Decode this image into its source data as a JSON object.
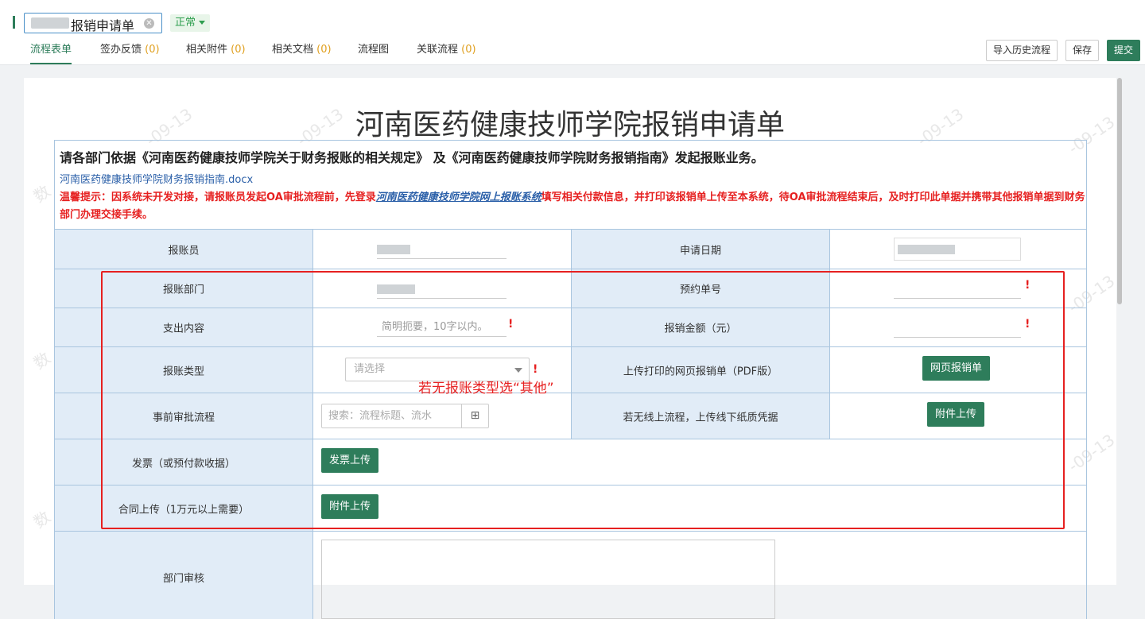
{
  "header": {
    "title": "报销申请单",
    "status": "正常",
    "tabs": [
      {
        "label": "流程表单",
        "count": ""
      },
      {
        "label": "签办反馈",
        "count": "(0)"
      },
      {
        "label": "相关附件",
        "count": "(0)"
      },
      {
        "label": "相关文档",
        "count": "(0)"
      },
      {
        "label": "流程图",
        "count": ""
      },
      {
        "label": "关联流程",
        "count": "(0)"
      }
    ],
    "buttons": {
      "import": "导入历史流程",
      "save": "保存",
      "submit": "提交"
    }
  },
  "watermark": {
    "date": "-09-13",
    "prefix": "数"
  },
  "form": {
    "title": "河南医药健康技师学院报销申请单",
    "notice_line1": "请各部门依据《河南医药健康技师学院关于财务报账的相关规定》 及《河南医药健康技师学院财务报销指南》发起报账业务。",
    "guide_link": "河南医药健康技师学院财务报销指南.docx",
    "tip_prefix": "温馨提示：因系统未开发对接，请报账员发起OA审批流程前，先登录",
    "tip_link": "河南医药健康技师学院网上报账系统",
    "tip_suffix": "填写相关付款信息，并打印该报销单上传至本系统，待OA审批流程结束后，及时打印此单据并携带其他报销单据到财务部门办理交接手续。",
    "labels": {
      "reporter": "报账员",
      "apply_date": "申请日期",
      "department": "报账部门",
      "booking_no": "预约单号",
      "content": "支出内容",
      "amount": "报销金额（元）",
      "type": "报账类型",
      "upload_pdf": "上传打印的网页报销单（PDF版）",
      "prior_flow": "事前审批流程",
      "offline": "若无线上流程，上传线下纸质凭据",
      "invoice": "发票（或预付款收据）",
      "contract": "合同上传（1万元以上需要）",
      "dept_review": "部门审核"
    },
    "placeholders": {
      "content": "简明扼要，10字以内。",
      "type": "请选择",
      "search": "搜索：流程标题、流水"
    },
    "buttons": {
      "web_form": "网页报销单",
      "attach1": "附件上传",
      "invoice_upload": "发票上传",
      "attach2": "附件上传"
    },
    "required_mark": "!"
  },
  "annotation": "若无报账类型选“其他”",
  "colors": {
    "accent": "#2e7d5b",
    "label_bg": "#e1ecf7",
    "alert": "#e62020",
    "link": "#2a5fa8"
  }
}
